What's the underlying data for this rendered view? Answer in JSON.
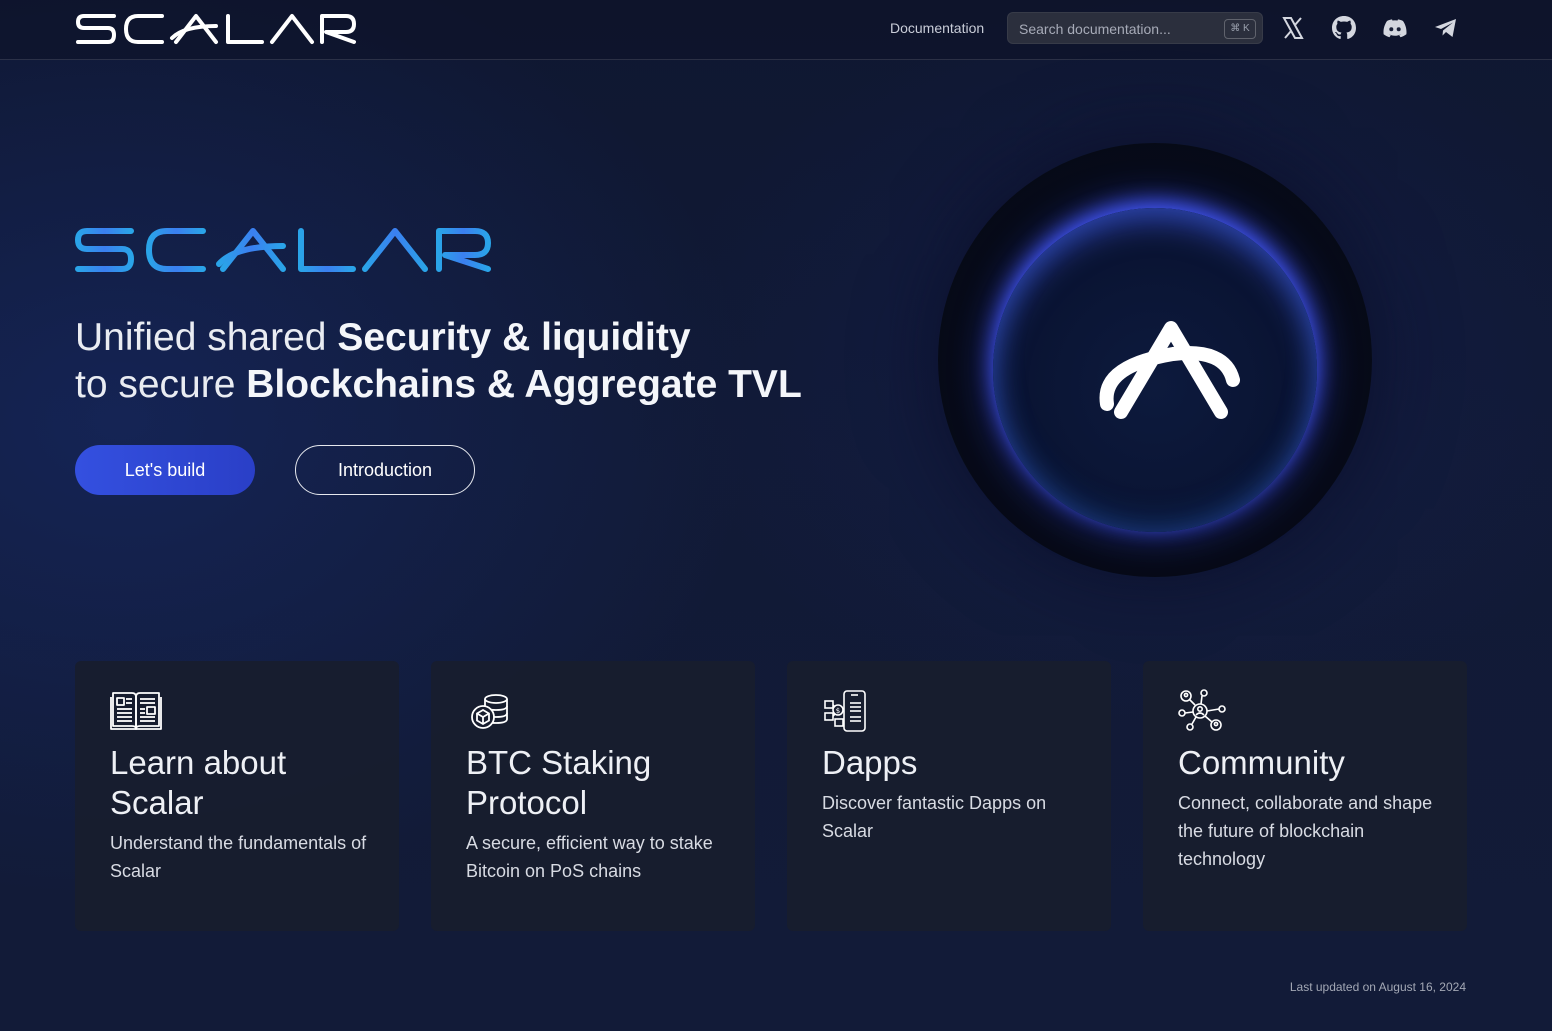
{
  "header": {
    "logo_text": "SCALAR",
    "nav_documentation": "Documentation",
    "search_placeholder": "Search documentation...",
    "search_shortcut": "⌘ K",
    "social_icons": [
      "x-icon",
      "github-icon",
      "discord-icon",
      "telegram-icon"
    ]
  },
  "hero": {
    "logo_text": "SCALAR",
    "line1_plain": "Unified shared ",
    "line1_bold": "Security & liquidity",
    "line2_plain": "to secure ",
    "line2_bold": "Blockchains & Aggregate TVL",
    "primary_button": "Let's build",
    "secondary_button": "Introduction"
  },
  "cards": [
    {
      "icon": "book-icon",
      "title": "Learn about Scalar",
      "description": "Understand the fundamentals of Scalar"
    },
    {
      "icon": "coins-icon",
      "title": "BTC Staking Protocol",
      "description": "A secure, efficient way to stake Bitcoin on PoS chains"
    },
    {
      "icon": "dapp-icon",
      "title": "Dapps",
      "description": "Discover fantastic Dapps on Scalar"
    },
    {
      "icon": "community-icon",
      "title": "Community",
      "description": "Connect, collaborate and shape the future of blockchain technology"
    }
  ],
  "footer": {
    "last_updated": "Last updated on August 16, 2024"
  },
  "colors": {
    "accent": "#3450e0",
    "logo_gradient_start": "#2aa4e8",
    "logo_gradient_end": "#4a6cf0",
    "background": "#111a36"
  }
}
